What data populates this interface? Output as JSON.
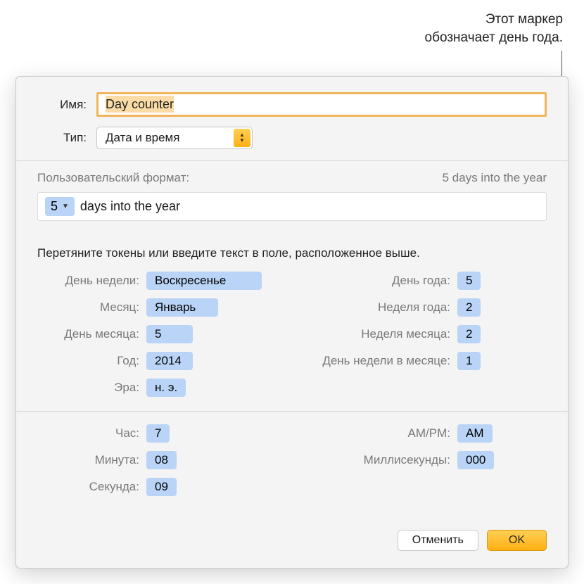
{
  "annotation": {
    "line1": "Этот маркер",
    "line2": "обозначает день года."
  },
  "labels": {
    "name": "Имя:",
    "type": "Тип:",
    "user_format": "Пользовательский формат:",
    "instruction": "Перетяните токены или введите текст в поле, расположенное выше."
  },
  "name_input": "Day counter",
  "type_select": "Дата и время",
  "format": {
    "preview": "5 days into the year",
    "token_value": "5",
    "suffix": " days into the year"
  },
  "tokens_left_1": [
    {
      "label": "День недели:",
      "value": "Воскресенье",
      "w": "w1"
    },
    {
      "label": "Месяц:",
      "value": "Январь",
      "w": "w2"
    },
    {
      "label": "День месяца:",
      "value": "5",
      "w": "w3"
    },
    {
      "label": "Год:",
      "value": "2014",
      "w": "w3"
    },
    {
      "label": "Эра:",
      "value": "н. э.",
      "w": "w5"
    }
  ],
  "tokens_right_1": [
    {
      "label": "День года:",
      "value": "5"
    },
    {
      "label": "Неделя года:",
      "value": "2"
    },
    {
      "label": "Неделя месяца:",
      "value": "2"
    },
    {
      "label": "День недели в месяце:",
      "value": "1"
    }
  ],
  "tokens_left_2": [
    {
      "label": "Час:",
      "value": "7"
    },
    {
      "label": "Минута:",
      "value": "08"
    },
    {
      "label": "Секунда:",
      "value": "09"
    }
  ],
  "tokens_right_2": [
    {
      "label": "AM/PM:",
      "value": "AM"
    },
    {
      "label": "Миллисекунды:",
      "value": "000"
    }
  ],
  "buttons": {
    "cancel": "Отменить",
    "ok": "OK"
  }
}
